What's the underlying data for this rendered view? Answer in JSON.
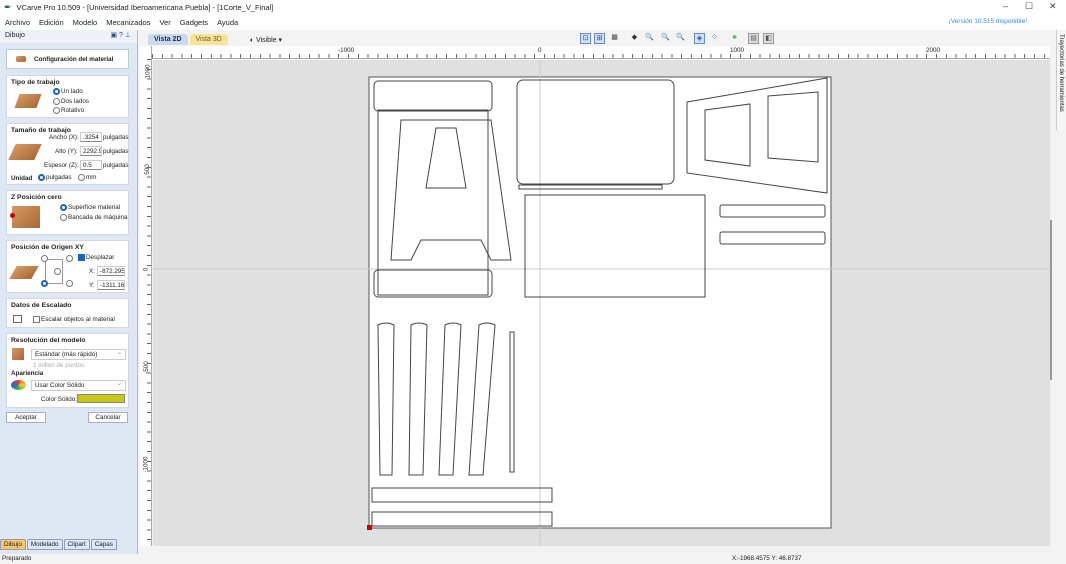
{
  "window": {
    "title": "VCarve Pro 10.509 - [Universidad Iberoamericana Puebla] - [1Corte_V_Final]",
    "update_notice": "¡Versión 10.515 disponible!"
  },
  "menu": [
    "Archivo",
    "Edición",
    "Modelo",
    "Mecanizados",
    "Ver",
    "Gadgets",
    "Ayuda"
  ],
  "panel": {
    "title": "Dibujo",
    "material_button": "Configuración del material",
    "job_type": {
      "title": "Tipo de trabajo",
      "options": [
        "Un lado",
        "Dos lados",
        "Rotativo"
      ],
      "selected": "Un lado"
    },
    "job_size": {
      "title": "Tamaño de trabajo",
      "width_label": "Ancho (X):",
      "width": ".3254",
      "height_label": "Alto (Y):",
      "height": "2292.9",
      "thickness_label": "Espesor (Z):",
      "thickness": "0.5",
      "unit_text": "pulgadas",
      "unit_label": "Unidad",
      "units": [
        "pulgadas",
        "mm"
      ],
      "selected_unit": "pulgadas"
    },
    "z_zero": {
      "title": "Z Posición cero",
      "options": [
        "Superficie material",
        "Bancada de máquina"
      ],
      "selected": "Superficie material"
    },
    "xy_origin": {
      "title": "Posición de Origen XY",
      "offset_label": "Desplazar",
      "offset_checked": true,
      "x_label": "X:",
      "x": "-872.295",
      "y_label": "Y:",
      "y": "-1311.16"
    },
    "scaling": {
      "title": "Datos de Escalado",
      "checkbox": "Escalar objetos al material",
      "checked": false
    },
    "resolution": {
      "title": "Resolución del modelo",
      "value": "Estándar (más rápido)",
      "hint": "1 millón de puntos"
    },
    "appearance": {
      "title": "Apariencia",
      "value": "Usar Color Sólido",
      "color_label": "Color Sólido:",
      "color": "#c8c814"
    },
    "ok": "Aceptar",
    "cancel": "Cancelar",
    "bottom_tabs": [
      "Dibujo",
      "Modelado",
      "Clipart",
      "Capas"
    ]
  },
  "view": {
    "tabs": [
      "Vista 2D",
      "Vista 3D"
    ],
    "visibility": "Visible",
    "side_tab": "Trayectorias de herramientas"
  },
  "rulers": {
    "h": [
      "-1000",
      "0",
      "1000",
      "2000"
    ],
    "v": [
      "1000",
      "500",
      "0",
      "-500",
      "-1000"
    ]
  },
  "status": {
    "left": "Preparado",
    "coords": "X:-1968.4575 Y: 46.8737"
  }
}
